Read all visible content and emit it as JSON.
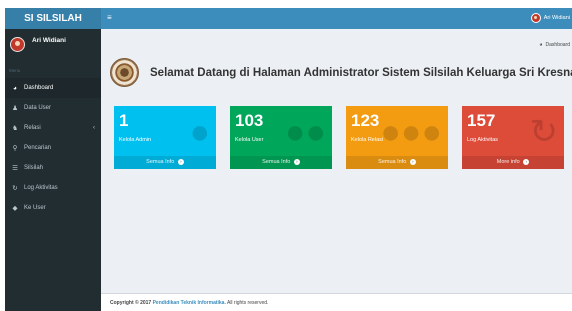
{
  "app": {
    "brand": "SI SILSILAH"
  },
  "header": {
    "toggle_icon": "bars-icon",
    "user_name": "Ari Widiani"
  },
  "sidebar": {
    "user_name": "Ari Widiani",
    "menu_header": "Menu",
    "items": [
      {
        "label": "Dashboard",
        "icon": "dashboard-icon",
        "active": true
      },
      {
        "label": "Data User",
        "icon": "user-icon",
        "active": false
      },
      {
        "label": "Relasi",
        "icon": "users-icon",
        "active": false
      },
      {
        "label": "Pencarian",
        "icon": "search-icon",
        "active": false
      },
      {
        "label": "Silsilah",
        "icon": "list-icon",
        "active": false
      },
      {
        "label": "Log Aktivitas",
        "icon": "refresh-icon",
        "active": false
      },
      {
        "label": "Ke User",
        "icon": "tag-icon",
        "active": false
      }
    ]
  },
  "breadcrumb": {
    "label": "Dashboard"
  },
  "page": {
    "title": "Selamat Datang di Halaman Administrator Sistem Silsilah Keluarga Sri Kresna Kepakisan"
  },
  "info_boxes": [
    {
      "number": "1",
      "label": "Kelola Admin",
      "footer": "Semua Info",
      "color": "#00c0ef"
    },
    {
      "number": "103",
      "label": "Kelola User",
      "footer": "Semua Info",
      "color": "#00a65a"
    },
    {
      "number": "123",
      "label": "Kelola Relasi",
      "footer": "Semua Info",
      "color": "#f39c12"
    },
    {
      "number": "157",
      "label": "Log Aktivitas",
      "footer": "More info",
      "color": "#dd4b39"
    }
  ],
  "footer": {
    "copyright": "Copyright © 2017",
    "link": "Pendidikan Teknik Informatika.",
    "rights": "All rights reserved."
  }
}
